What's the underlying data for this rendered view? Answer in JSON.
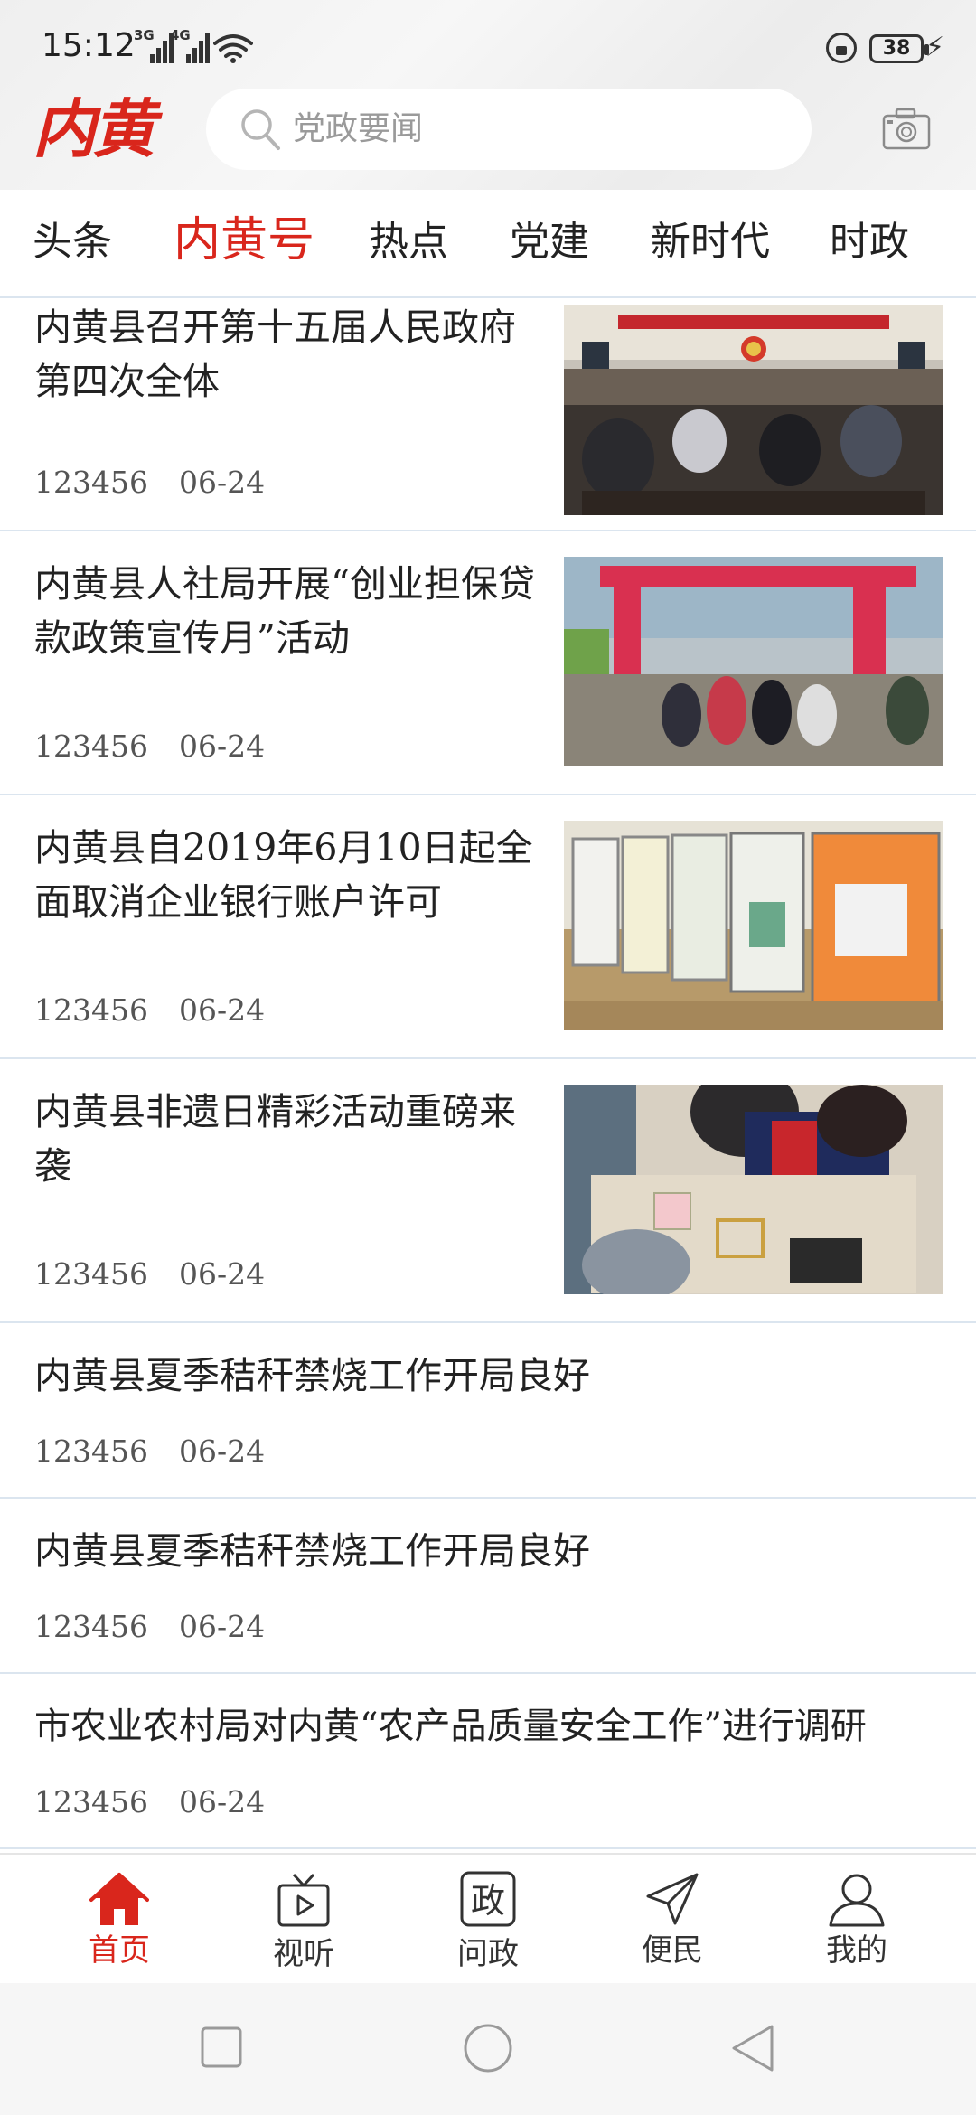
{
  "status": {
    "time": "15:12",
    "network_1": "3G",
    "network_2": "4G",
    "battery": "38"
  },
  "header": {
    "logo": "内黄",
    "search_placeholder": "党政要闻"
  },
  "tabs": [
    {
      "label": "头条"
    },
    {
      "label": "内黄号"
    },
    {
      "label": "热点"
    },
    {
      "label": "党建"
    },
    {
      "label": "新时代"
    },
    {
      "label": "时政"
    }
  ],
  "active_tab": "内黄号",
  "feed": [
    {
      "title": " 内黄县召开第十五届人民政府第四次全体",
      "views": "123456",
      "date": "06-24",
      "image": "government-meeting-photo"
    },
    {
      "title": "内黄县人社局开展“创业担保贷款政策宣传月”活动",
      "views": "123456",
      "date": "06-24",
      "image": "street-promotion-event-photo"
    },
    {
      "title": "内黄县自2019年6月10日起全面取消企业银行账户许可",
      "views": "123456",
      "date": "06-24",
      "image": "bank-poster-boards-photo"
    },
    {
      "title": "内黄县非遗日精彩活动重磅来袭",
      "views": "123456",
      "date": "06-24",
      "image": "handicraft-activity-photo"
    },
    {
      "title": "内黄县夏季秸秆禁烧工作开局良好",
      "views": "123456",
      "date": "06-24"
    },
    {
      "title": "内黄县夏季秸秆禁烧工作开局良好",
      "views": "123456",
      "date": "06-24"
    },
    {
      "title": "市农业农村局对内黄“农产品质量安全工作”进行调研",
      "views": "123456",
      "date": "06-24"
    }
  ],
  "bottom_nav": [
    {
      "label": "首页",
      "icon": "home-icon",
      "active": true
    },
    {
      "label": "视听",
      "icon": "tv-icon",
      "active": false
    },
    {
      "label": "问政",
      "icon": "zheng-badge-icon",
      "active": false
    },
    {
      "label": "便民",
      "icon": "paper-plane-icon",
      "active": false
    },
    {
      "label": "我的",
      "icon": "user-icon",
      "active": false
    }
  ],
  "nav_badge_text": "政",
  "colors": {
    "accent": "#d9261c",
    "divider": "#dbe5ef",
    "text": "#222222",
    "muted": "#555555"
  }
}
